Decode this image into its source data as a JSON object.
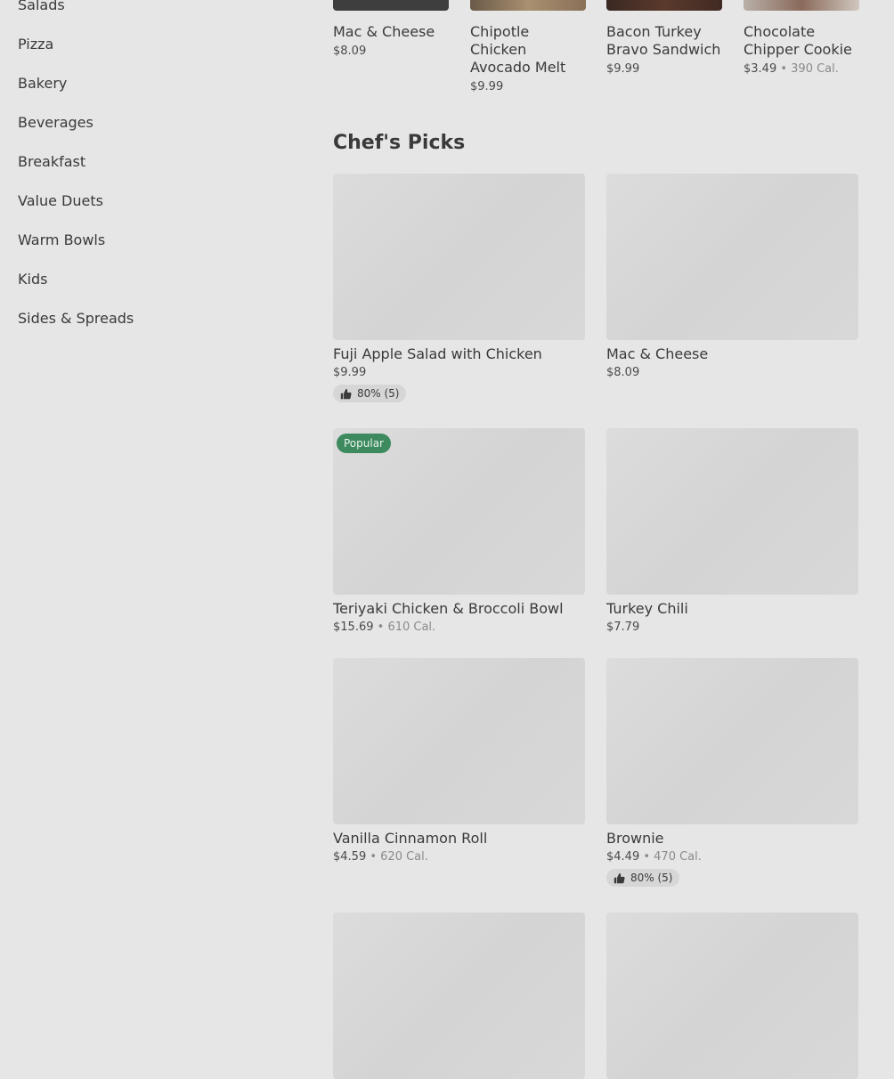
{
  "sidebar": {
    "items": [
      {
        "label": "Salads"
      },
      {
        "label": "Pizza"
      },
      {
        "label": "Bakery"
      },
      {
        "label": "Beverages"
      },
      {
        "label": "Breakfast"
      },
      {
        "label": "Value Duets"
      },
      {
        "label": "Warm Bowls"
      },
      {
        "label": "Kids"
      },
      {
        "label": "Sides & Spreads"
      }
    ]
  },
  "top_row": [
    {
      "name": "Mac & Cheese",
      "price": "$8.09",
      "cal": ""
    },
    {
      "name": "Chipotle Chicken Avocado Melt",
      "price": "$9.99",
      "cal": ""
    },
    {
      "name": "Bacon Turkey Bravo Sandwich",
      "price": "$9.99",
      "cal": ""
    },
    {
      "name": "Chocolate Chipper Cookie",
      "price": "$3.49",
      "cal": "390 Cal."
    }
  ],
  "section_title": "Chef's Picks",
  "picks": [
    {
      "name": "Fuji Apple Salad with Chicken",
      "price": "$9.99",
      "cal": "",
      "rating": "80% (5)",
      "badge": ""
    },
    {
      "name": "Mac & Cheese",
      "price": "$8.09",
      "cal": "",
      "rating": "",
      "badge": ""
    },
    {
      "name": "Teriyaki Chicken & Broccoli Bowl",
      "price": "$15.69",
      "cal": "610 Cal.",
      "rating": "",
      "badge": "Popular"
    },
    {
      "name": "Turkey Chili",
      "price": "$7.79",
      "cal": "",
      "rating": "",
      "badge": ""
    },
    {
      "name": "Vanilla Cinnamon Roll",
      "price": "$4.59",
      "cal": "620 Cal.",
      "rating": "",
      "badge": ""
    },
    {
      "name": "Brownie",
      "price": "$4.49",
      "cal": "470 Cal.",
      "rating": "80% (5)",
      "badge": ""
    }
  ],
  "separator": " • ",
  "icons": {
    "rating": "thumbs-up-icon"
  },
  "colors": {
    "badge": "#3e8a5f",
    "background": "#e6e6e6"
  }
}
